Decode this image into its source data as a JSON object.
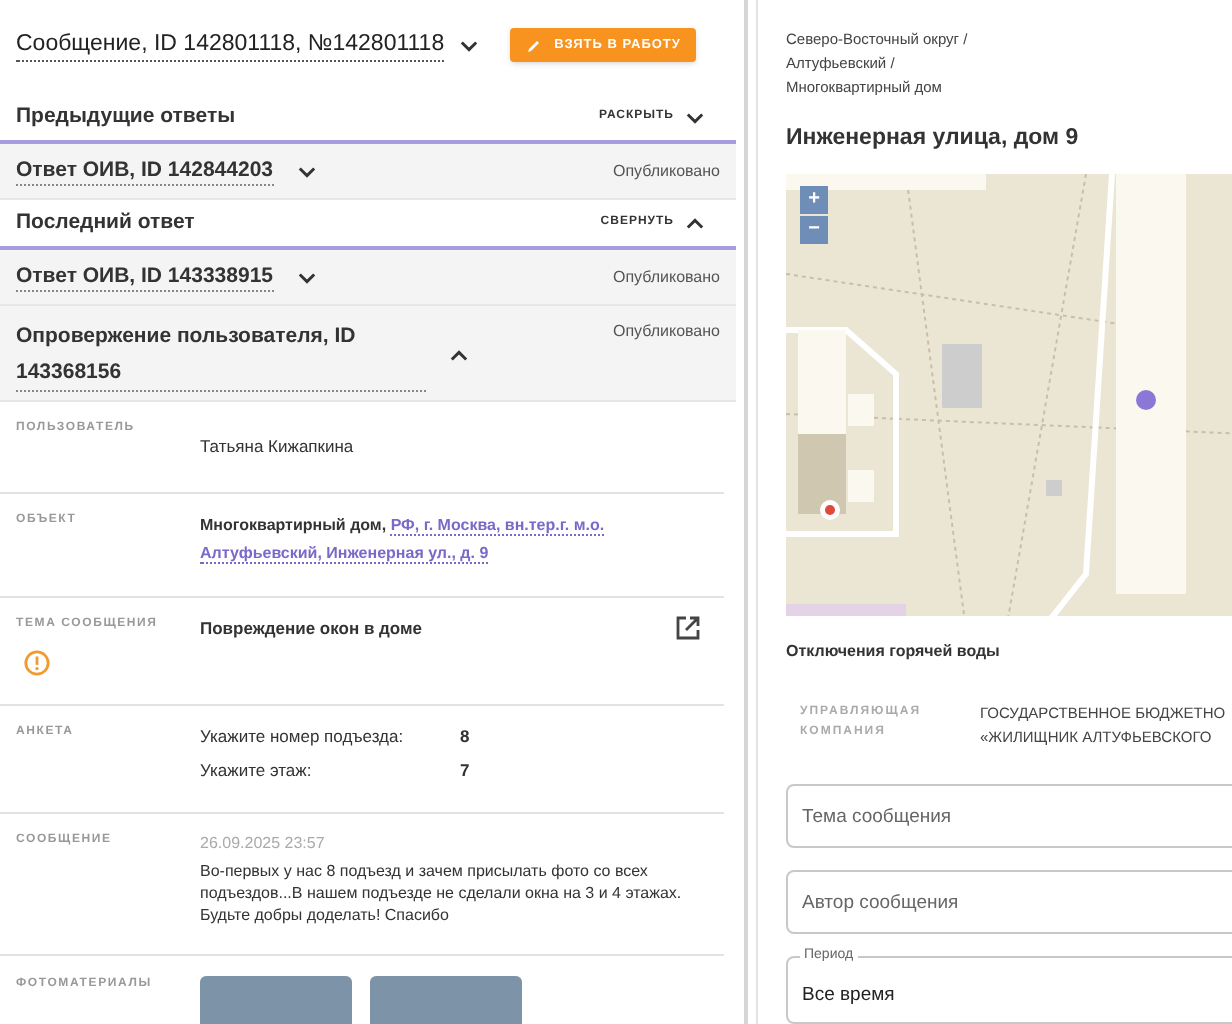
{
  "header": {
    "title": "Сообщение, ID 142801118, №142801118",
    "action_button": "ВЗЯТЬ В РАБОТУ"
  },
  "sections": [
    {
      "title": "Предыдущие ответы",
      "toggle": "РАСКРЫТЬ",
      "expanded": false,
      "items": [
        {
          "title": "Ответ ОИВ, ID 142844203",
          "status": "Опубликовано",
          "expanded": false
        }
      ]
    },
    {
      "title": "Последний ответ",
      "toggle": "СВЕРНУТЬ",
      "expanded": true,
      "items": [
        {
          "title": "Ответ ОИВ, ID 143338915",
          "status": "Опубликовано",
          "expanded": false
        },
        {
          "title": "Опровержение пользователя, ID 143368156",
          "status": "Опубликовано",
          "expanded": true
        }
      ]
    }
  ],
  "details": [
    {
      "kind": "text",
      "label": "ПОЛЬЗОВАТЕЛЬ",
      "value": "Татьяна Кижапкина"
    },
    {
      "kind": "object",
      "label": "ОБЪЕКТ",
      "prefix": "Многоквартирный дом,",
      "link": "РФ, г. Москва, вн.тер.г. м.о. Алтуфьевский, Инженерная ул., д. 9"
    },
    {
      "kind": "topic",
      "label": "ТЕМА СООБЩЕНИЯ",
      "value": "Повреждение окон в доме",
      "warning": true
    },
    {
      "kind": "survey",
      "label": "АНКЕТА",
      "answers": [
        {
          "question": "Укажите номер подъезда:",
          "answer": "8"
        },
        {
          "question": "Укажите этаж:",
          "answer": "7"
        }
      ]
    },
    {
      "kind": "message",
      "label": "СООБЩЕНИЕ",
      "date": "26.09.2025 23:57",
      "text": "Во-первых у нас 8 подъезд и зачем присылать фото со всех подъездов...В нашем подъезде не сделали окна на 3 и 4 этажах. Будьте добры доделать! Спасибо"
    },
    {
      "kind": "photos",
      "label": "ФОТОМАТЕРИАЛЫ",
      "photos": [
        {
          "kind": "photo"
        },
        {
          "kind": "photo"
        }
      ]
    }
  ],
  "object_panel": {
    "breadcrumb": "Северо-Восточный округ / Алтуфьевский / Многоквартирный дом",
    "title": "Инженерная улица, дом 9",
    "map": {
      "zoom_in": "+",
      "zoom_out": "−"
    },
    "notice": "Отключения горячей воды",
    "company_label": "УПРАВЛЯЮЩАЯ КОМПАНИЯ",
    "company_lines": [
      "ГОСУДАРСТВЕННОЕ БЮДЖЕТНО",
      "«ЖИЛИЩНИК АЛТУФЬЕВСКОГО"
    ],
    "filters": [
      {
        "kind": "input",
        "placeholder": "Тема сообщения"
      },
      {
        "kind": "input",
        "placeholder": "Автор сообщения"
      },
      {
        "kind": "select",
        "label": "Период",
        "value": "Все время"
      }
    ]
  }
}
